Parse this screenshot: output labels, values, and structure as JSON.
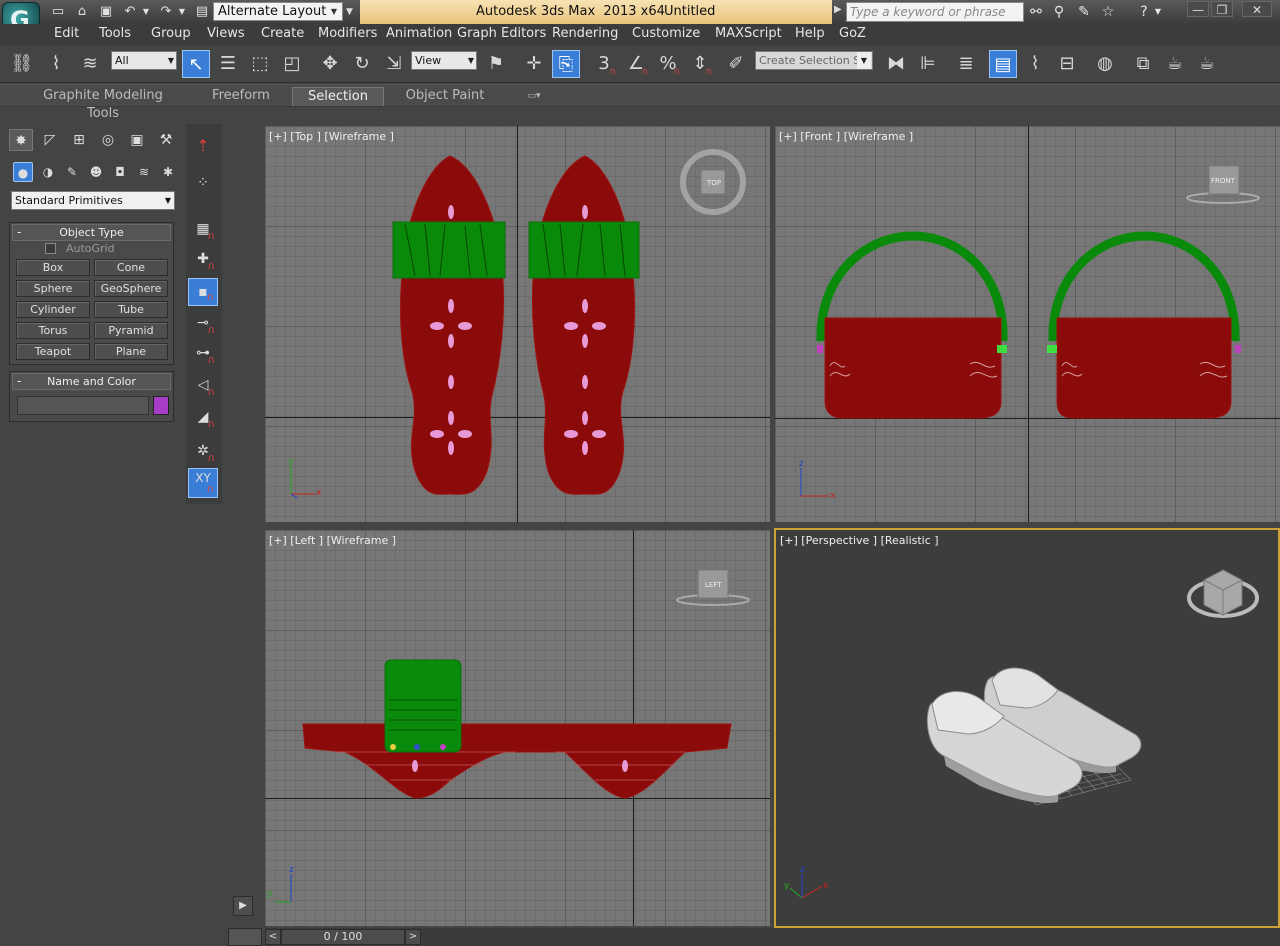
{
  "title_bar": {
    "layout_name": "Alternate Layout",
    "app_title": "Autodesk 3ds Max  2013 x64",
    "document_title": "Untitled",
    "search_placeholder": "Type a keyword or phrase"
  },
  "menu": [
    "Edit",
    "Tools",
    "Group",
    "Views",
    "Create",
    "Modifiers",
    "Animation",
    "Graph Editors",
    "Rendering",
    "Customize",
    "MAXScript",
    "Help",
    "GoZ"
  ],
  "toolbar": {
    "selection_filter": "All",
    "reference_coord": "View",
    "snap_3_label": "3",
    "percent_snap_label": "%",
    "named_selection_placeholder": "Create Selection Se"
  },
  "ribbon_tabs": [
    {
      "label": "Graphite Modeling Tools",
      "active": false
    },
    {
      "label": "Freeform",
      "active": false
    },
    {
      "label": "Selection",
      "active": true
    },
    {
      "label": "Object Paint",
      "active": false
    }
  ],
  "command_panel": {
    "category": "Standard Primitives",
    "object_type": {
      "title": "Object Type",
      "autogrid_label": "AutoGrid",
      "buttons": [
        "Box",
        "Cone",
        "Sphere",
        "GeoSphere",
        "Cylinder",
        "Tube",
        "Torus",
        "Pyramid",
        "Teapot",
        "Plane"
      ]
    },
    "name_and_color": {
      "title": "Name and Color",
      "name_value": "",
      "swatch_color": "#a63dc4"
    }
  },
  "snap_toolbar": {
    "xy_label": "XY"
  },
  "viewports": {
    "top": {
      "label": "[+] [Top ] [Wireframe ]",
      "cube_label": "TOP"
    },
    "front": {
      "label": "[+] [Front ] [Wireframe ]",
      "cube_label": "FRONT"
    },
    "left": {
      "label": "[+] [Left ] [Wireframe ]",
      "cube_label": "LEFT"
    },
    "perspective": {
      "label": "[+] [Perspective ] [Realistic ]"
    }
  },
  "axis_labels": {
    "x": "x",
    "y": "y",
    "z": "z"
  },
  "colors": {
    "sole_red": "#8b0a0a",
    "strap_green": "#0a8a0a",
    "active_viewport_border": "#caa236",
    "toolbar_active_blue": "#3a7ed8"
  },
  "timeline": {
    "frame_display": "0 / 100",
    "frame_current": 0,
    "frame_total": 100
  }
}
